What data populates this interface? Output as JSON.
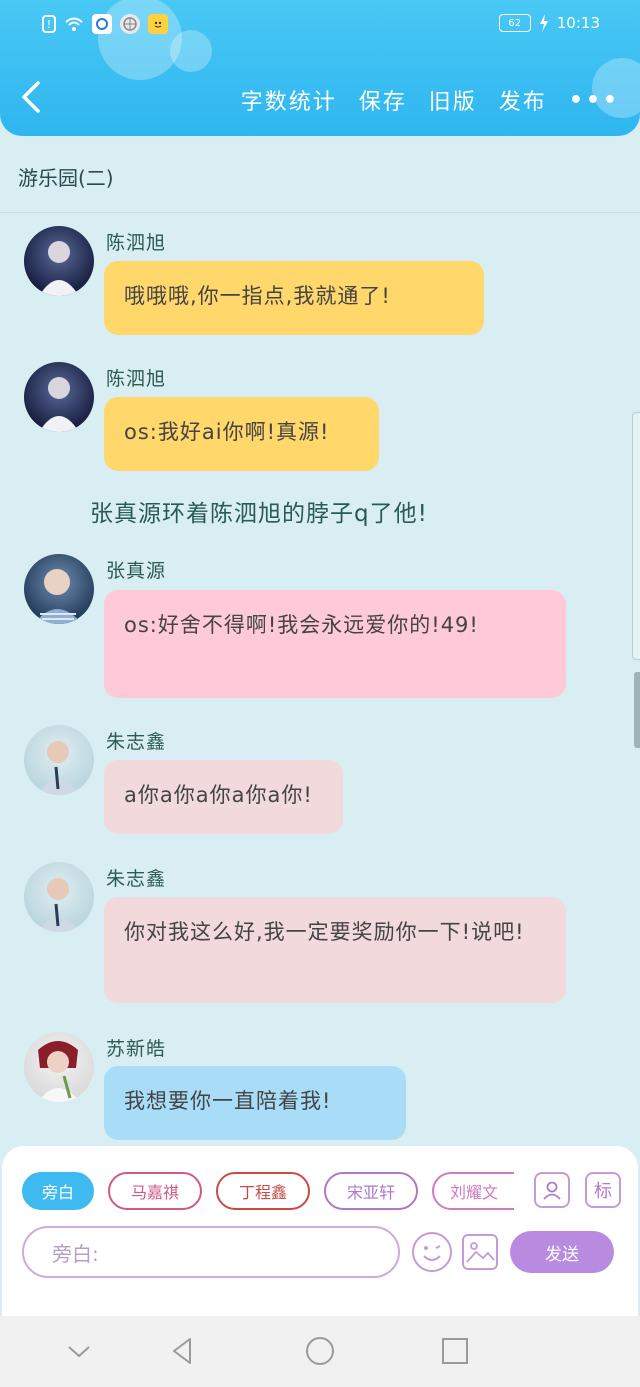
{
  "status_bar": {
    "battery": "62",
    "time": "10:13"
  },
  "header": {
    "actions": [
      "字数统计",
      "保存",
      "旧版",
      "发布"
    ],
    "more": "•••"
  },
  "chapter_title": "游乐园(二)",
  "messages": [
    {
      "sender": "陈泗旭",
      "text": "哦哦哦,你一指点,我就通了!",
      "color": "#ffd76a"
    },
    {
      "sender": "陈泗旭",
      "text": "os:我好ai你啊!真源!",
      "color": "#ffd76a"
    },
    {
      "sender": "张真源",
      "text": "os:好舍不得啊!我会永远爱你的!49!",
      "color": "#ffcad8"
    },
    {
      "sender": "朱志鑫",
      "text": "a你a你a你a你a你!",
      "color": "#f1d9dc"
    },
    {
      "sender": "朱志鑫",
      "text": "你对我这么好,我一定要奖励你一下!说吧!",
      "color": "#f1d9dc"
    },
    {
      "sender": "苏新皓",
      "text": "我想要你一直陪着我!",
      "color": "#a9ddf7"
    }
  ],
  "narration": "张真源环着陈泗旭的脖子q了他!",
  "composer": {
    "chips": [
      {
        "label": "旁白",
        "color": "#3fbaf0"
      },
      {
        "label": "马嘉祺",
        "color": "#d05a86"
      },
      {
        "label": "丁程鑫",
        "color": "#c94c44"
      },
      {
        "label": "宋亚轩",
        "color": "#b077c8"
      },
      {
        "label": "刘耀文",
        "color": "#d07ac0"
      }
    ],
    "tag_button": "标",
    "input_placeholder": "旁白:",
    "send_label": "发送"
  }
}
